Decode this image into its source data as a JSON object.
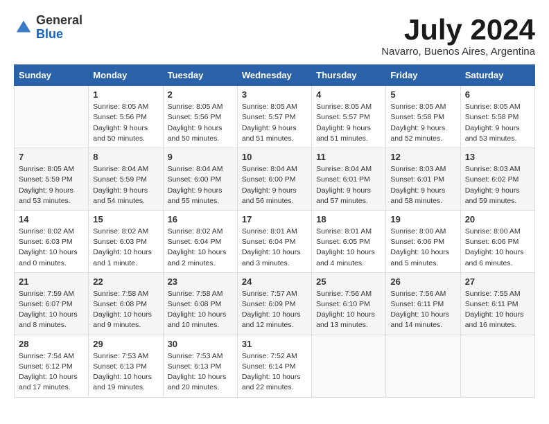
{
  "header": {
    "logo_general": "General",
    "logo_blue": "Blue",
    "month_title": "July 2024",
    "location": "Navarro, Buenos Aires, Argentina"
  },
  "days_of_week": [
    "Sunday",
    "Monday",
    "Tuesday",
    "Wednesday",
    "Thursday",
    "Friday",
    "Saturday"
  ],
  "weeks": [
    [
      {
        "day": "",
        "data": ""
      },
      {
        "day": "1",
        "data": "Sunrise: 8:05 AM\nSunset: 5:56 PM\nDaylight: 9 hours\nand 50 minutes."
      },
      {
        "day": "2",
        "data": "Sunrise: 8:05 AM\nSunset: 5:56 PM\nDaylight: 9 hours\nand 50 minutes."
      },
      {
        "day": "3",
        "data": "Sunrise: 8:05 AM\nSunset: 5:57 PM\nDaylight: 9 hours\nand 51 minutes."
      },
      {
        "day": "4",
        "data": "Sunrise: 8:05 AM\nSunset: 5:57 PM\nDaylight: 9 hours\nand 51 minutes."
      },
      {
        "day": "5",
        "data": "Sunrise: 8:05 AM\nSunset: 5:58 PM\nDaylight: 9 hours\nand 52 minutes."
      },
      {
        "day": "6",
        "data": "Sunrise: 8:05 AM\nSunset: 5:58 PM\nDaylight: 9 hours\nand 53 minutes."
      }
    ],
    [
      {
        "day": "7",
        "data": "Sunrise: 8:05 AM\nSunset: 5:59 PM\nDaylight: 9 hours\nand 53 minutes."
      },
      {
        "day": "8",
        "data": "Sunrise: 8:04 AM\nSunset: 5:59 PM\nDaylight: 9 hours\nand 54 minutes."
      },
      {
        "day": "9",
        "data": "Sunrise: 8:04 AM\nSunset: 6:00 PM\nDaylight: 9 hours\nand 55 minutes."
      },
      {
        "day": "10",
        "data": "Sunrise: 8:04 AM\nSunset: 6:00 PM\nDaylight: 9 hours\nand 56 minutes."
      },
      {
        "day": "11",
        "data": "Sunrise: 8:04 AM\nSunset: 6:01 PM\nDaylight: 9 hours\nand 57 minutes."
      },
      {
        "day": "12",
        "data": "Sunrise: 8:03 AM\nSunset: 6:01 PM\nDaylight: 9 hours\nand 58 minutes."
      },
      {
        "day": "13",
        "data": "Sunrise: 8:03 AM\nSunset: 6:02 PM\nDaylight: 9 hours\nand 59 minutes."
      }
    ],
    [
      {
        "day": "14",
        "data": "Sunrise: 8:02 AM\nSunset: 6:03 PM\nDaylight: 10 hours\nand 0 minutes."
      },
      {
        "day": "15",
        "data": "Sunrise: 8:02 AM\nSunset: 6:03 PM\nDaylight: 10 hours\nand 1 minute."
      },
      {
        "day": "16",
        "data": "Sunrise: 8:02 AM\nSunset: 6:04 PM\nDaylight: 10 hours\nand 2 minutes."
      },
      {
        "day": "17",
        "data": "Sunrise: 8:01 AM\nSunset: 6:04 PM\nDaylight: 10 hours\nand 3 minutes."
      },
      {
        "day": "18",
        "data": "Sunrise: 8:01 AM\nSunset: 6:05 PM\nDaylight: 10 hours\nand 4 minutes."
      },
      {
        "day": "19",
        "data": "Sunrise: 8:00 AM\nSunset: 6:06 PM\nDaylight: 10 hours\nand 5 minutes."
      },
      {
        "day": "20",
        "data": "Sunrise: 8:00 AM\nSunset: 6:06 PM\nDaylight: 10 hours\nand 6 minutes."
      }
    ],
    [
      {
        "day": "21",
        "data": "Sunrise: 7:59 AM\nSunset: 6:07 PM\nDaylight: 10 hours\nand 8 minutes."
      },
      {
        "day": "22",
        "data": "Sunrise: 7:58 AM\nSunset: 6:08 PM\nDaylight: 10 hours\nand 9 minutes."
      },
      {
        "day": "23",
        "data": "Sunrise: 7:58 AM\nSunset: 6:08 PM\nDaylight: 10 hours\nand 10 minutes."
      },
      {
        "day": "24",
        "data": "Sunrise: 7:57 AM\nSunset: 6:09 PM\nDaylight: 10 hours\nand 12 minutes."
      },
      {
        "day": "25",
        "data": "Sunrise: 7:56 AM\nSunset: 6:10 PM\nDaylight: 10 hours\nand 13 minutes."
      },
      {
        "day": "26",
        "data": "Sunrise: 7:56 AM\nSunset: 6:11 PM\nDaylight: 10 hours\nand 14 minutes."
      },
      {
        "day": "27",
        "data": "Sunrise: 7:55 AM\nSunset: 6:11 PM\nDaylight: 10 hours\nand 16 minutes."
      }
    ],
    [
      {
        "day": "28",
        "data": "Sunrise: 7:54 AM\nSunset: 6:12 PM\nDaylight: 10 hours\nand 17 minutes."
      },
      {
        "day": "29",
        "data": "Sunrise: 7:53 AM\nSunset: 6:13 PM\nDaylight: 10 hours\nand 19 minutes."
      },
      {
        "day": "30",
        "data": "Sunrise: 7:53 AM\nSunset: 6:13 PM\nDaylight: 10 hours\nand 20 minutes."
      },
      {
        "day": "31",
        "data": "Sunrise: 7:52 AM\nSunset: 6:14 PM\nDaylight: 10 hours\nand 22 minutes."
      },
      {
        "day": "",
        "data": ""
      },
      {
        "day": "",
        "data": ""
      },
      {
        "day": "",
        "data": ""
      }
    ]
  ]
}
